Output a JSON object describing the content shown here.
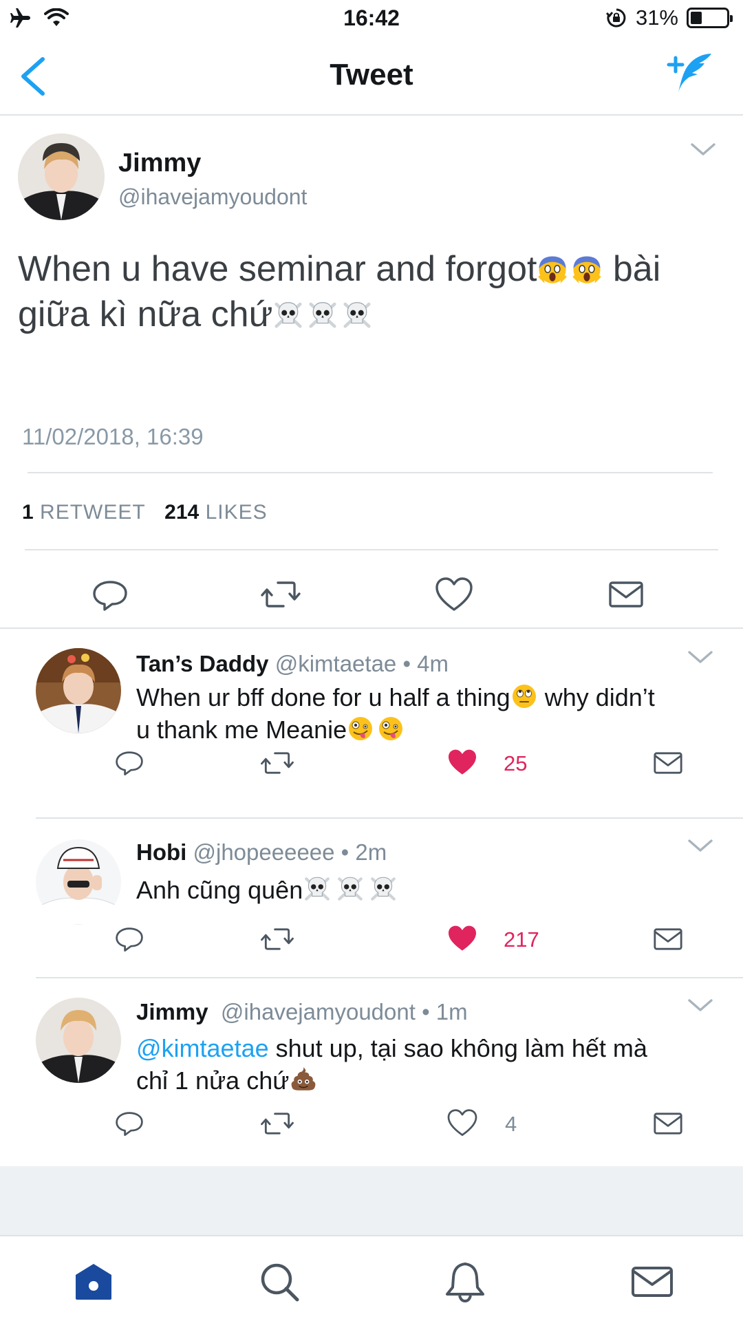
{
  "status_bar": {
    "time": "16:42",
    "battery": "31%",
    "battery_level": 0.31,
    "icons": [
      "airplane-icon",
      "wifi-icon",
      "rotation-lock-icon",
      "battery-icon"
    ]
  },
  "nav": {
    "title": "Tweet",
    "back_icon": "back-chevron-icon",
    "compose_icon": "compose-tweet-icon"
  },
  "main_tweet": {
    "name": "Jimmy",
    "handle": "@ihavejamyoudont",
    "text_line1": "When u have seminar and forgot",
    "text_line1_tail": " bài",
    "text_line2": "giữa kì nữa chứ",
    "timestamp": "11/02/2018, 16:39",
    "retweet_count": "1",
    "retweet_label": "RETWEET",
    "like_count": "214",
    "like_label": "LIKES"
  },
  "replies": [
    {
      "name": "Tan’s Daddy",
      "meta": "@kimtaetae • 4m",
      "line1": "When ur bff done for u half a thing",
      "line1_tail": " why didn’t",
      "line2": "u thank me Meanie",
      "like_count": "25",
      "liked": true
    },
    {
      "name": "Hobi",
      "meta": "@jhopeeeeee • 2m",
      "line1": "Anh cũng quên",
      "like_count": "217",
      "liked": true
    },
    {
      "name": "Jimmy",
      "meta": "@ihavejamyoudont • 1m",
      "mention": "@kimtaetae",
      "line1_tail": " shut up, tại sao không làm hết mà",
      "line2": "chỉ 1 nửa chứ",
      "like_count": "4",
      "liked": false
    }
  ],
  "tab_bar": {
    "tabs": [
      "home-icon",
      "search-icon",
      "notifications-icon",
      "messages-icon"
    ],
    "active": "home-icon"
  },
  "colors": {
    "accent": "#1da1f2",
    "like_red": "#e0245e",
    "meta_gray": "#7d8b97",
    "divider": "#dfe3e6",
    "tab_active": "#1a4a9e"
  }
}
